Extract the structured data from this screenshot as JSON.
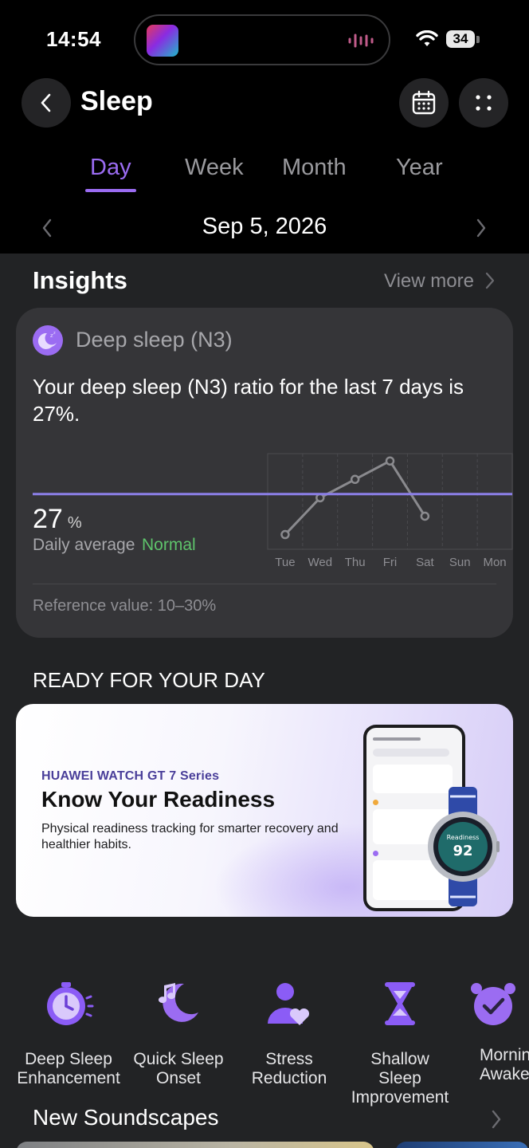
{
  "status_bar": {
    "time": "14:54",
    "battery": "34"
  },
  "header": {
    "title": "Sleep"
  },
  "tabs": [
    {
      "label": "Day"
    },
    {
      "label": "Week"
    },
    {
      "label": "Month"
    },
    {
      "label": "Year"
    }
  ],
  "date_nav": {
    "date": "Sep 5, 2026"
  },
  "insights": {
    "title": "Insights",
    "view_more": "View more",
    "card": {
      "heading": "Deep sleep (N3)",
      "text": "Your deep sleep (N3) ratio for the last 7 days is 27%.",
      "average_value": "27",
      "average_unit": "%",
      "average_caption": "Daily average",
      "status": "Normal",
      "reference": "Reference value: 10–30%"
    }
  },
  "chart_data": {
    "type": "line",
    "x": [
      "Tue",
      "Wed",
      "Thu",
      "Fri",
      "Sat",
      "Sun",
      "Mon"
    ],
    "values": [
      8,
      28,
      38,
      48,
      18,
      null,
      null
    ],
    "ylim": [
      0,
      52
    ],
    "average_line": 30,
    "grid": true,
    "colors": {
      "line": "#8a8a8e",
      "average": "#8b7fe8"
    }
  },
  "ready": {
    "title": "READY FOR YOUR DAY",
    "banner": {
      "brand": "HUAWEI WATCH GT 7 Series",
      "title": "Know Your Readiness",
      "subtitle": "Physical readiness tracking for smarter recovery and healthier habits."
    }
  },
  "shortcuts": [
    {
      "label": "Deep Sleep\nEnhancement",
      "icon": "stopwatch-icon"
    },
    {
      "label": "Quick Sleep\nOnset",
      "icon": "moon-note-icon"
    },
    {
      "label": "Stress\nReduction",
      "icon": "person-heart-icon"
    },
    {
      "label": "Shallow Sleep\nImprovement",
      "icon": "hourglass-icon"
    },
    {
      "label": "Mornin\nAwaken",
      "icon": "alarm-check-icon"
    }
  ],
  "soundscapes": {
    "title": "New Soundscapes"
  },
  "colors": {
    "accent": "#9b6cf2",
    "normal": "#5ec36b",
    "background": "#222325"
  }
}
